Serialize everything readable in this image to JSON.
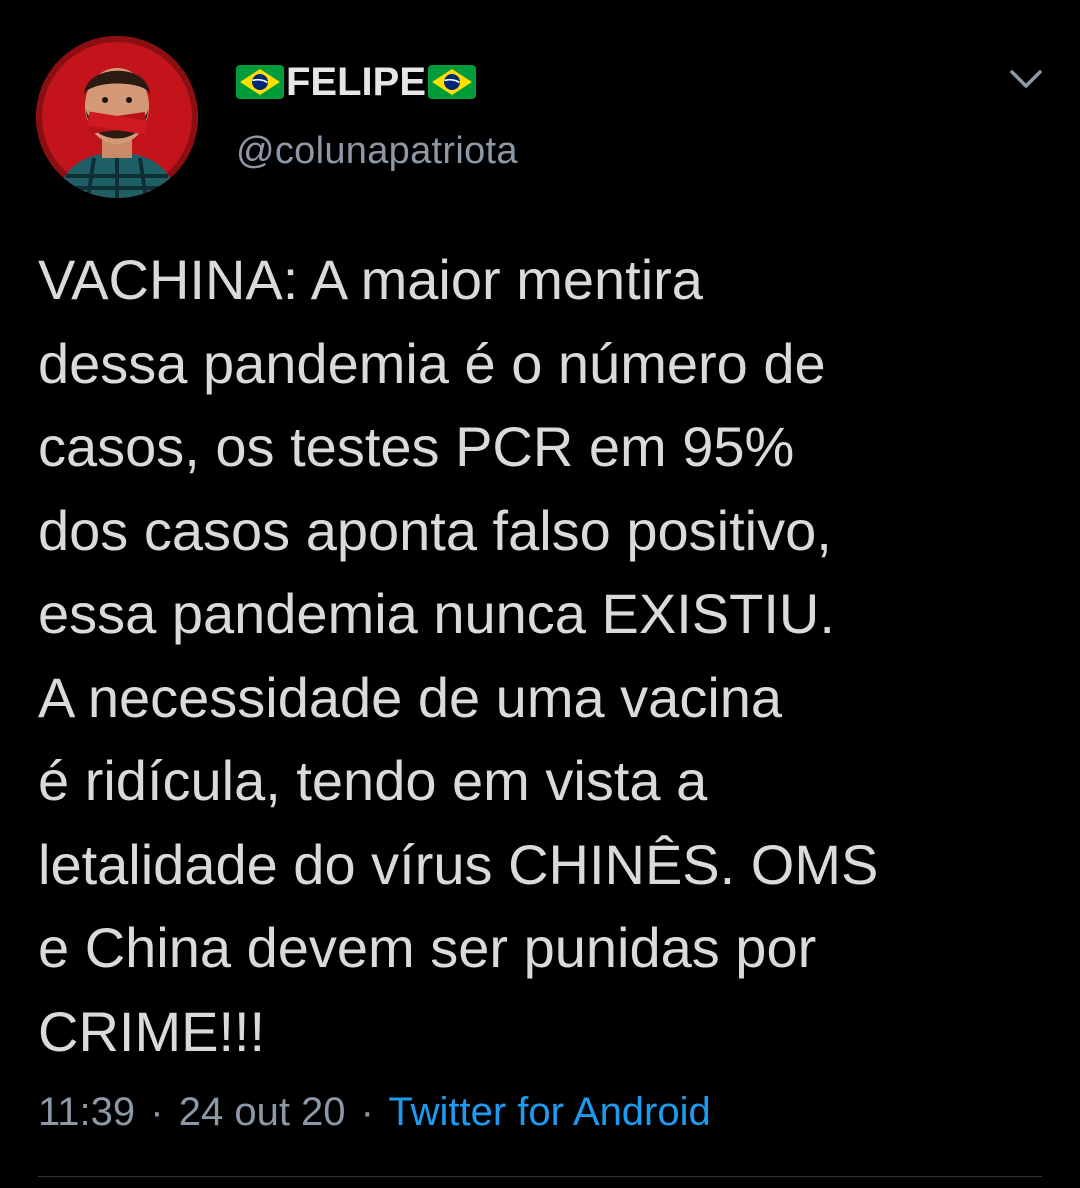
{
  "tweet": {
    "author": {
      "display_name": "FELIPE",
      "left_flag_icon": "brazil-flag-icon",
      "right_flag_icon": "brazil-flag-icon",
      "handle": "@colunapatriota",
      "avatar_icon": "user-avatar"
    },
    "menu_icon": "chevron-down-icon",
    "text": "VACHINA: A maior mentira\ndessa pandemia é o número de\ncasos, os testes PCR em 95%\ndos casos aponta falso positivo,\nessa pandemia nunca EXISTIU.\nA necessidade de uma vacina\né ridícula, tendo em vista a\nletalidade do vírus CHINÊS. OMS\ne China devem ser punidas por\nCRIME!!!",
    "time": "11:39",
    "separator": "·",
    "date": "24 out 20",
    "source": "Twitter for Android"
  },
  "colors": {
    "background": "#000000",
    "text": "#dadada",
    "secondary_text": "#8b98a5",
    "link": "#1d9bf0",
    "avatar_bg": "#c2141a",
    "flag_green": "#009b3a",
    "flag_yellow": "#fedf00",
    "flag_blue": "#002776"
  }
}
